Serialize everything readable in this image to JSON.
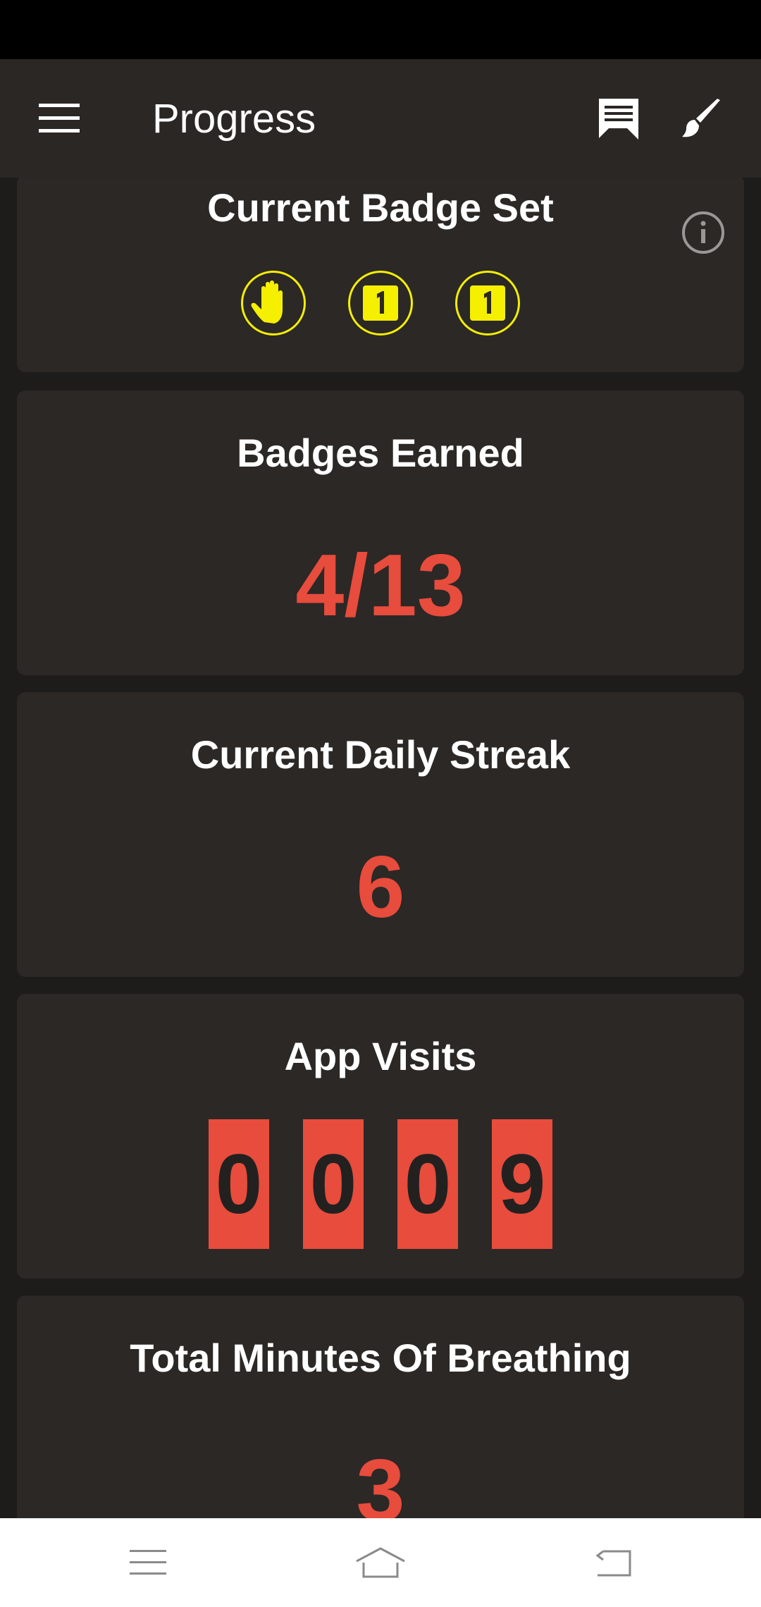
{
  "app_bar": {
    "title": "Progress",
    "icons": [
      "hamburger-menu-icon",
      "chat-icon",
      "brush-icon"
    ]
  },
  "cards": {
    "badge_set": {
      "title": "Current Badge Set",
      "info_icon": "info-icon",
      "badges": [
        {
          "icon": "hand-badge-icon",
          "color": "#f5ef00"
        },
        {
          "icon": "number-one-badge-icon",
          "label": "1",
          "color": "#f5ef00"
        },
        {
          "icon": "number-one-badge-icon",
          "label": "1",
          "color": "#f5ef00"
        }
      ]
    },
    "badges_earned": {
      "title": "Badges Earned",
      "value": "4/13"
    },
    "daily_streak": {
      "title": "Current Daily Streak",
      "value": "6"
    },
    "app_visits": {
      "title": "App Visits",
      "digits": [
        "0",
        "0",
        "0",
        "9"
      ]
    },
    "breathing": {
      "title": "Total Minutes Of Breathing",
      "value": "3"
    }
  },
  "colors": {
    "accent": "#e74c3c",
    "badge": "#f5ef00",
    "card_bg": "#2b2826",
    "page_bg": "#1d1c1b",
    "app_bar_bg": "#2a2725"
  },
  "nav_bar": {
    "icons": [
      "recent-apps-icon",
      "home-icon",
      "back-icon"
    ]
  }
}
